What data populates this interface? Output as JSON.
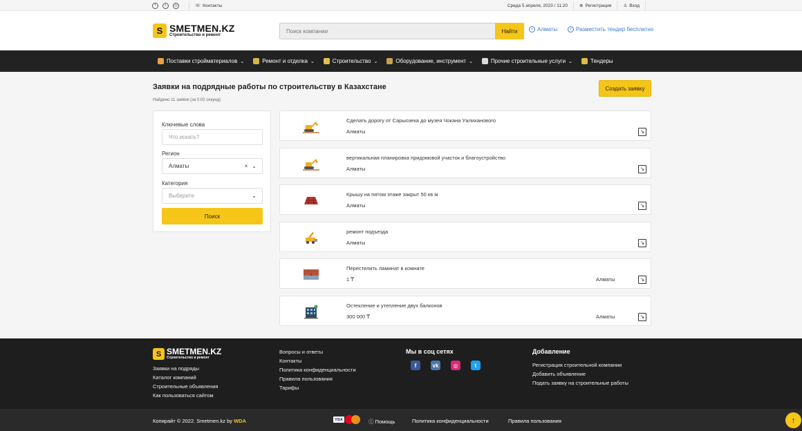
{
  "topbar": {
    "contacts": "Контакты",
    "datetime": "Среда 5 апреля, 2023 / 11:20",
    "register": "Регистрация",
    "login": "Вход"
  },
  "header": {
    "logo_main": "SMETMEN.KZ",
    "logo_sub": "Строительство и ремонт",
    "logo_letter": "S",
    "search_placeholder": "Поиск компании",
    "search_button": "Найти",
    "city": "Алматы",
    "tender_link": "Разместить тендер бесплатно"
  },
  "nav": [
    {
      "label": "Поставки стройматериалов",
      "icon": "materials-icon",
      "color": "#e8a33c",
      "chevron": true
    },
    {
      "label": "Ремонт и отделка",
      "icon": "repair-icon",
      "color": "#d8b24a",
      "chevron": true
    },
    {
      "label": "Строительство",
      "icon": "construction-icon",
      "color": "#e5c14a",
      "chevron": true
    },
    {
      "label": "Оборудование, инструмент",
      "icon": "tools-icon",
      "color": "#c9a04d",
      "chevron": true
    },
    {
      "label": "Прочие строительные услуги",
      "icon": "services-icon",
      "color": "#dcdcdc",
      "chevron": true
    },
    {
      "label": "Тендеры",
      "icon": "tenders-icon",
      "color": "#e0b94a",
      "chevron": false
    }
  ],
  "main": {
    "title": "Заявки на подрядные работы по строительству в Казахстане",
    "found": "Найдено 11 заявок (за 0.02 секунд)",
    "create_button": "Создать заявку"
  },
  "filter": {
    "keywords_label": "Ключевые слова",
    "keywords_placeholder": "Что искать?",
    "region_label": "Регион",
    "region_value": "Алматы",
    "category_label": "Категория",
    "category_placeholder": "Выберите",
    "search_button": "Поиск"
  },
  "requests": [
    {
      "title": "Сделать дорогу от Сарыозека до музея Чокана Уалиханового",
      "sub": "Алматы",
      "city_right": "",
      "icon": "excavator-icon"
    },
    {
      "title": "вертикальная планировка придомовой участок и благоустройство",
      "sub": "Алматы",
      "city_right": "",
      "icon": "excavator-icon"
    },
    {
      "title": "Крышу на пятом этаже закрыт 50 кв м",
      "sub": "Алматы",
      "city_right": "",
      "icon": "roof-icon"
    },
    {
      "title": "ремонт подъезда",
      "sub": "Алматы",
      "city_right": "",
      "icon": "crane-truck-icon"
    },
    {
      "title": "Перестелить ламинат в комнате",
      "sub": "1 ₸",
      "city_right": "Алматы",
      "icon": "wall-icon"
    },
    {
      "title": "Остекление и утепление двух балконов",
      "sub": "300 000 ₸",
      "city_right": "Алматы",
      "icon": "building-icon"
    }
  ],
  "footer": {
    "logo_main": "SMETMEN.KZ",
    "logo_sub": "Строительство и ремонт",
    "col1": [
      "Заявки на подряды",
      "Каталог компаний",
      "Строительные объявления",
      "Как пользоваться сайтом"
    ],
    "col2": [
      "Вопросы и ответы",
      "Контакты",
      "Политика конфиденциальности",
      "Правила пользования",
      "Тарифы"
    ],
    "social_heading": "Мы в соц сетях",
    "socials": [
      {
        "name": "facebook-icon",
        "glyph": "f",
        "color": "#3b5998"
      },
      {
        "name": "vk-icon",
        "glyph": "vk",
        "color": "#4a76a8"
      },
      {
        "name": "instagram-icon",
        "glyph": "◎",
        "color": "#d62976"
      },
      {
        "name": "twitter-icon",
        "glyph": "t",
        "color": "#1da1f2"
      }
    ],
    "add_heading": "Добавление",
    "col4": [
      "Регистрация строительной компании",
      "Добавить объявление",
      "Подать заявку на строительные работы"
    ]
  },
  "bottom": {
    "copyright": "Копирайт © 2022. Smetmen.kz by ",
    "wda": "WDA",
    "visa": "VISA",
    "help": "Помощь",
    "privacy": "Политика конфиденциальности",
    "rules": "Правила пользования"
  }
}
